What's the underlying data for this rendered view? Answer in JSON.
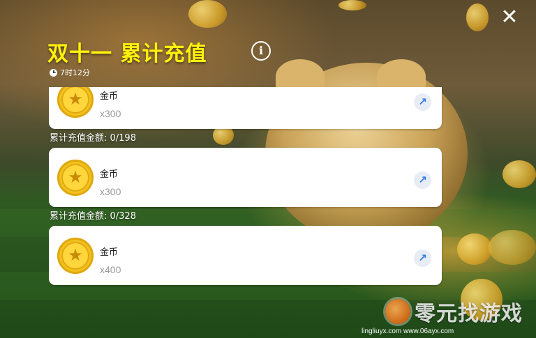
{
  "header": {
    "title": "双十一 累计充值",
    "info_icon": "info-icon",
    "close_icon": "close-icon",
    "timer": "7时12分"
  },
  "rewards": [
    {
      "requirement": "",
      "name": "金币",
      "quantity": "x300",
      "icon": "coin-star-icon",
      "action_icon": "arrow-up-right-icon"
    },
    {
      "requirement": "累计充值金额: 0/198",
      "name": "金币",
      "quantity": "x300",
      "icon": "coin-star-icon",
      "action_icon": "arrow-up-right-icon"
    },
    {
      "requirement": "累计充值金额: 0/328",
      "name": "金币",
      "quantity": "x400",
      "icon": "coin-star-icon",
      "action_icon": "arrow-up-right-icon"
    }
  ],
  "watermark": {
    "text": "零元找游戏",
    "url": "lingliuyx.com www.06ayx.com"
  },
  "colors": {
    "title": "#fff20a",
    "card_bg": "#ffffff",
    "action_arrow": "#2f7de1",
    "coin": "#f2c21c"
  }
}
